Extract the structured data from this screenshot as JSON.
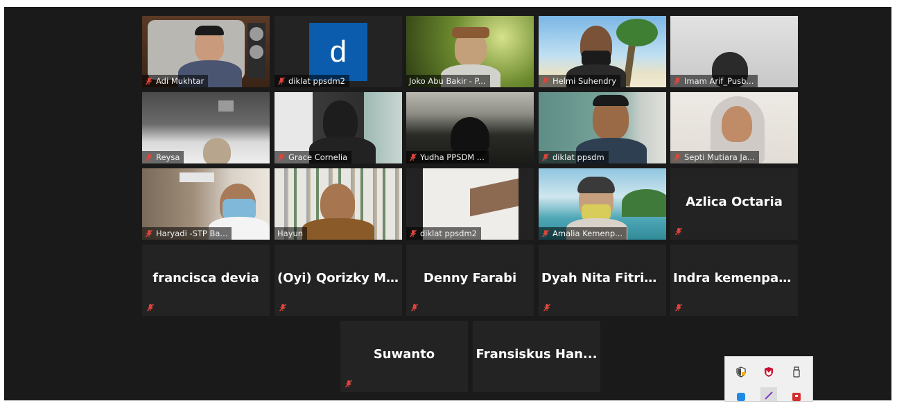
{
  "participants": [
    {
      "name": "Adi Mukhtar"
    },
    {
      "name": "diklat ppsdm2",
      "avatar_letter": "d"
    },
    {
      "name": "Joko Abu Bakir - P..."
    },
    {
      "name": "Helmi Suhendry"
    },
    {
      "name": "Imam Arif_Pusb..."
    },
    {
      "name": "Reysa"
    },
    {
      "name": "Grace Cornelia"
    },
    {
      "name": "Yudha PPSDM ..."
    },
    {
      "name": "diklat ppsdm"
    },
    {
      "name": "Septi Mutiara Ja..."
    },
    {
      "name": "Haryadi -STP Ba..."
    },
    {
      "name": "Hayun"
    },
    {
      "name": "diklat ppsdm2"
    },
    {
      "name": "Amalia Kemenp..."
    },
    {
      "name": "Azlica Octaria"
    },
    {
      "name": "francisca devia"
    },
    {
      "name": "(Oyi) Qorizky M..."
    },
    {
      "name": "Denny Farabi"
    },
    {
      "name": "Dyah Nita Fitriani"
    },
    {
      "name": "Indra kemenpar..."
    },
    {
      "name": "Suwanto"
    },
    {
      "name": "Fransiskus Han..."
    }
  ],
  "colors": {
    "background": "#1a1a1a",
    "tile": "#232323",
    "active_speaker": "#d7e05a",
    "muted_mic": "#e0453b",
    "avatar_blue": "#0b5cad"
  },
  "tray_icons": [
    {
      "icon": "security-shield-icon"
    },
    {
      "icon": "mcafee-icon"
    },
    {
      "icon": "usb-drive-icon"
    },
    {
      "icon": "blue-app-icon"
    },
    {
      "icon": "pen-icon"
    },
    {
      "icon": "red-app-icon"
    }
  ]
}
